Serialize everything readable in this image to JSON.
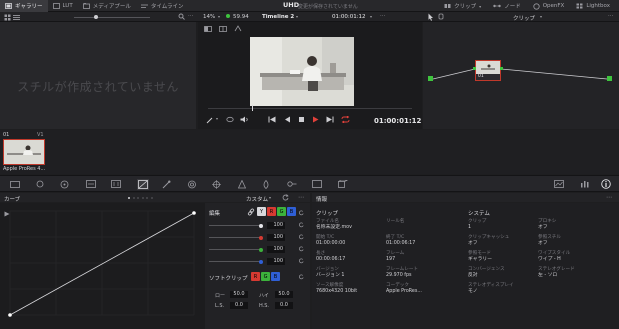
{
  "topbar": {
    "tabs": [
      {
        "label": "ギャラリー",
        "icon": "gallery-icon",
        "active": true
      },
      {
        "label": "LUT",
        "icon": "lut-icon",
        "active": false
      },
      {
        "label": "メディアプール",
        "icon": "media-pool-icon",
        "active": false
      },
      {
        "label": "タイムライン",
        "icon": "timeline-icon",
        "active": false
      }
    ],
    "project_title": "UHD",
    "save_status": "変更が保存されていません",
    "right_tabs": [
      {
        "label": "クリップ",
        "icon": "clips-icon"
      },
      {
        "label": "ノード",
        "icon": "nodes-icon"
      },
      {
        "label": "OpenFX",
        "icon": "openfx-icon"
      },
      {
        "label": "Lightbox",
        "icon": "lightbox-icon"
      }
    ]
  },
  "viewer": {
    "zoom": "14%",
    "fps": "59.94",
    "timeline_name": "Timeline 2",
    "timecode_top": "01:00:01:12",
    "timecode_bottom": "01:00:01:12"
  },
  "gallery": {
    "empty_message": "スチルが作成されていません"
  },
  "nodes": {
    "mode_label": "クリップ",
    "node_label": "01"
  },
  "clips": {
    "index": "01",
    "track": "V1",
    "clip_name": "Apple ProRes 4..."
  },
  "curves": {
    "panel_title": "カーブ",
    "mode_dropdown": "カスタム",
    "edit_label": "編集",
    "channel_buttons": [
      "Y",
      "R",
      "G",
      "B"
    ],
    "channel_values": [
      "100",
      "100",
      "100",
      "100"
    ],
    "soft_clip_label": "ソフトクリップ",
    "soft_clip_channels": [
      "R",
      "G",
      "B"
    ],
    "low_label": "ロー",
    "low_value": "50.0",
    "high_label": "ハイ",
    "high_value": "50.0",
    "ls_label": "L.S.",
    "ls_value": "0.0",
    "hs_label": "H.S.",
    "hs_value": "0.0"
  },
  "info": {
    "panel_title": "情報",
    "clip_section": "クリップ",
    "system_section": "システム",
    "clip_fields": [
      {
        "label": "ファイル名",
        "value": "名称未設定.mov",
        "col": 0
      },
      {
        "label": "リール名",
        "value": "",
        "col": 1
      },
      {
        "label": "開始 T/C",
        "value": "01:00:00:00",
        "col": 0
      },
      {
        "label": "終了 T/C",
        "value": "01:00:06:17",
        "col": 1
      },
      {
        "label": "長さ",
        "value": "00:00:06:17",
        "col": 0
      },
      {
        "label": "フレーム",
        "value": "197",
        "col": 1
      },
      {
        "label": "バージョン",
        "value": "バージョン 1",
        "col": 0
      },
      {
        "label": "フレームレート",
        "value": "29.970 fps",
        "col": 1
      },
      {
        "label": "ソース解像度",
        "value": "7680x4320 10bit",
        "col": 0
      },
      {
        "label": "コーデック",
        "value": "Apple ProRes...",
        "col": 1
      }
    ],
    "system_fields": [
      {
        "label": "クリップ",
        "value": "1",
        "col": 0
      },
      {
        "label": "プロキシ",
        "value": "オフ",
        "col": 1
      },
      {
        "label": "クリップキャッシュ",
        "value": "オフ",
        "col": 0
      },
      {
        "label": "参照スチル",
        "value": "オフ",
        "col": 1
      },
      {
        "label": "参照モード",
        "value": "ギャラリー",
        "col": 0
      },
      {
        "label": "ワイプスタイル",
        "value": "ワイプ - H",
        "col": 1
      },
      {
        "label": "コンバージェンス",
        "value": "反対",
        "col": 0
      },
      {
        "label": "ステレオグレード",
        "value": "左 - ソロ",
        "col": 1
      },
      {
        "label": "ステレオディスプレイ",
        "value": "モノ",
        "col": 0
      }
    ]
  },
  "colors": {
    "accent_red": "#c0392b",
    "playhead_red": "#e0403a",
    "node_green": "#3ec43e",
    "panel_bg": "#1e1e20"
  }
}
